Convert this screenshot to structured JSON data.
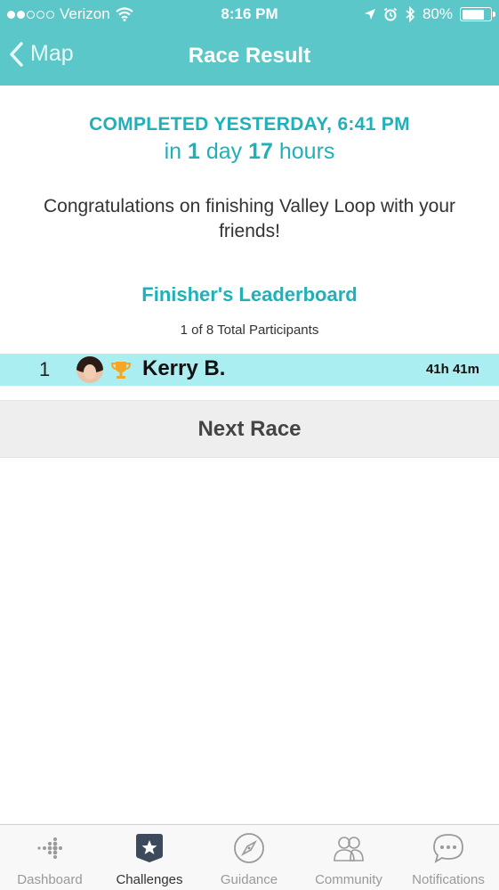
{
  "status_bar": {
    "carrier": "Verizon",
    "time": "8:16 PM",
    "battery": "80%",
    "battery_level": 0.8
  },
  "nav": {
    "back_label": "Map",
    "title": "Race Result"
  },
  "result": {
    "completed": "COMPLETED YESTERDAY, 6:41 PM",
    "duration_prefix": "in",
    "duration_days": "1",
    "duration_days_unit": "day",
    "duration_hours": "17",
    "duration_hours_unit": "hours",
    "message": "Congratulations on finishing Valley Loop with your friends!"
  },
  "leaderboard": {
    "title": "Finisher's Leaderboard",
    "participants": "1 of 8 Total Participants",
    "rows": [
      {
        "rank": "1",
        "name": "Kerry B.",
        "time": "41h 41m"
      }
    ]
  },
  "next_race_label": "Next Race",
  "tabs": [
    {
      "label": "Dashboard",
      "icon": "fitbit-dots-icon",
      "active": false
    },
    {
      "label": "Challenges",
      "icon": "star-badge-icon",
      "active": true
    },
    {
      "label": "Guidance",
      "icon": "compass-icon",
      "active": false
    },
    {
      "label": "Community",
      "icon": "people-icon",
      "active": false
    },
    {
      "label": "Notifications",
      "icon": "chat-bubble-icon",
      "active": false
    }
  ],
  "colors": {
    "accent": "#5cc7c8",
    "accent_text": "#1fb0b8",
    "highlight_row": "#aaeef2",
    "trophy": "#f5a623"
  }
}
